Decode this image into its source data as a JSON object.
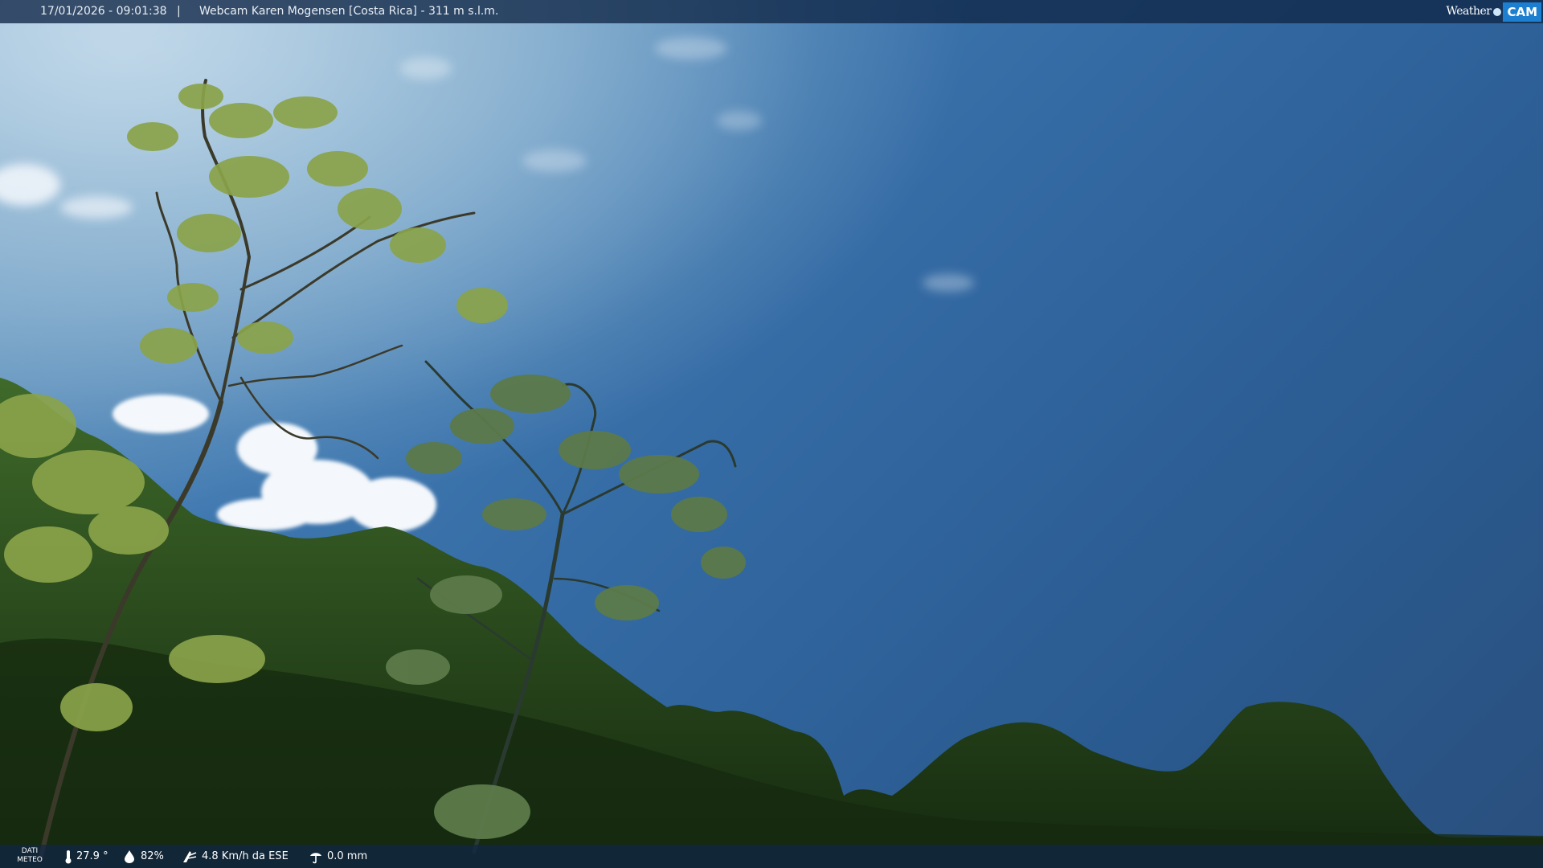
{
  "overlay_top": {
    "timestamp": "17/01/2026 - 09:01:38",
    "separator": "|",
    "title": "Webcam Karen Mogensen [Costa Rica] - 311 m s.l.m.",
    "logo_weather": "Weather",
    "logo_cam": "CAM"
  },
  "overlay_bottom": {
    "label_line1": "DATI",
    "label_line2": "METEO",
    "temperature": "27.9 °",
    "humidity": "82%",
    "wind": "4.8 Km/h da ESE",
    "rain": "0.0 mm"
  },
  "icons": {
    "temperature": "thermometer-icon",
    "humidity": "humidity-drop-icon",
    "wind": "wind-icon",
    "rain": "rain-icon"
  },
  "colors": {
    "sky_dark": "#2a5a8f",
    "sky_light": "#a9c8df",
    "foliage_dark": "#1f3a1c",
    "foliage_light": "#7c9a3a",
    "bar": "#102646",
    "logo_accent": "#1d7fcf"
  }
}
